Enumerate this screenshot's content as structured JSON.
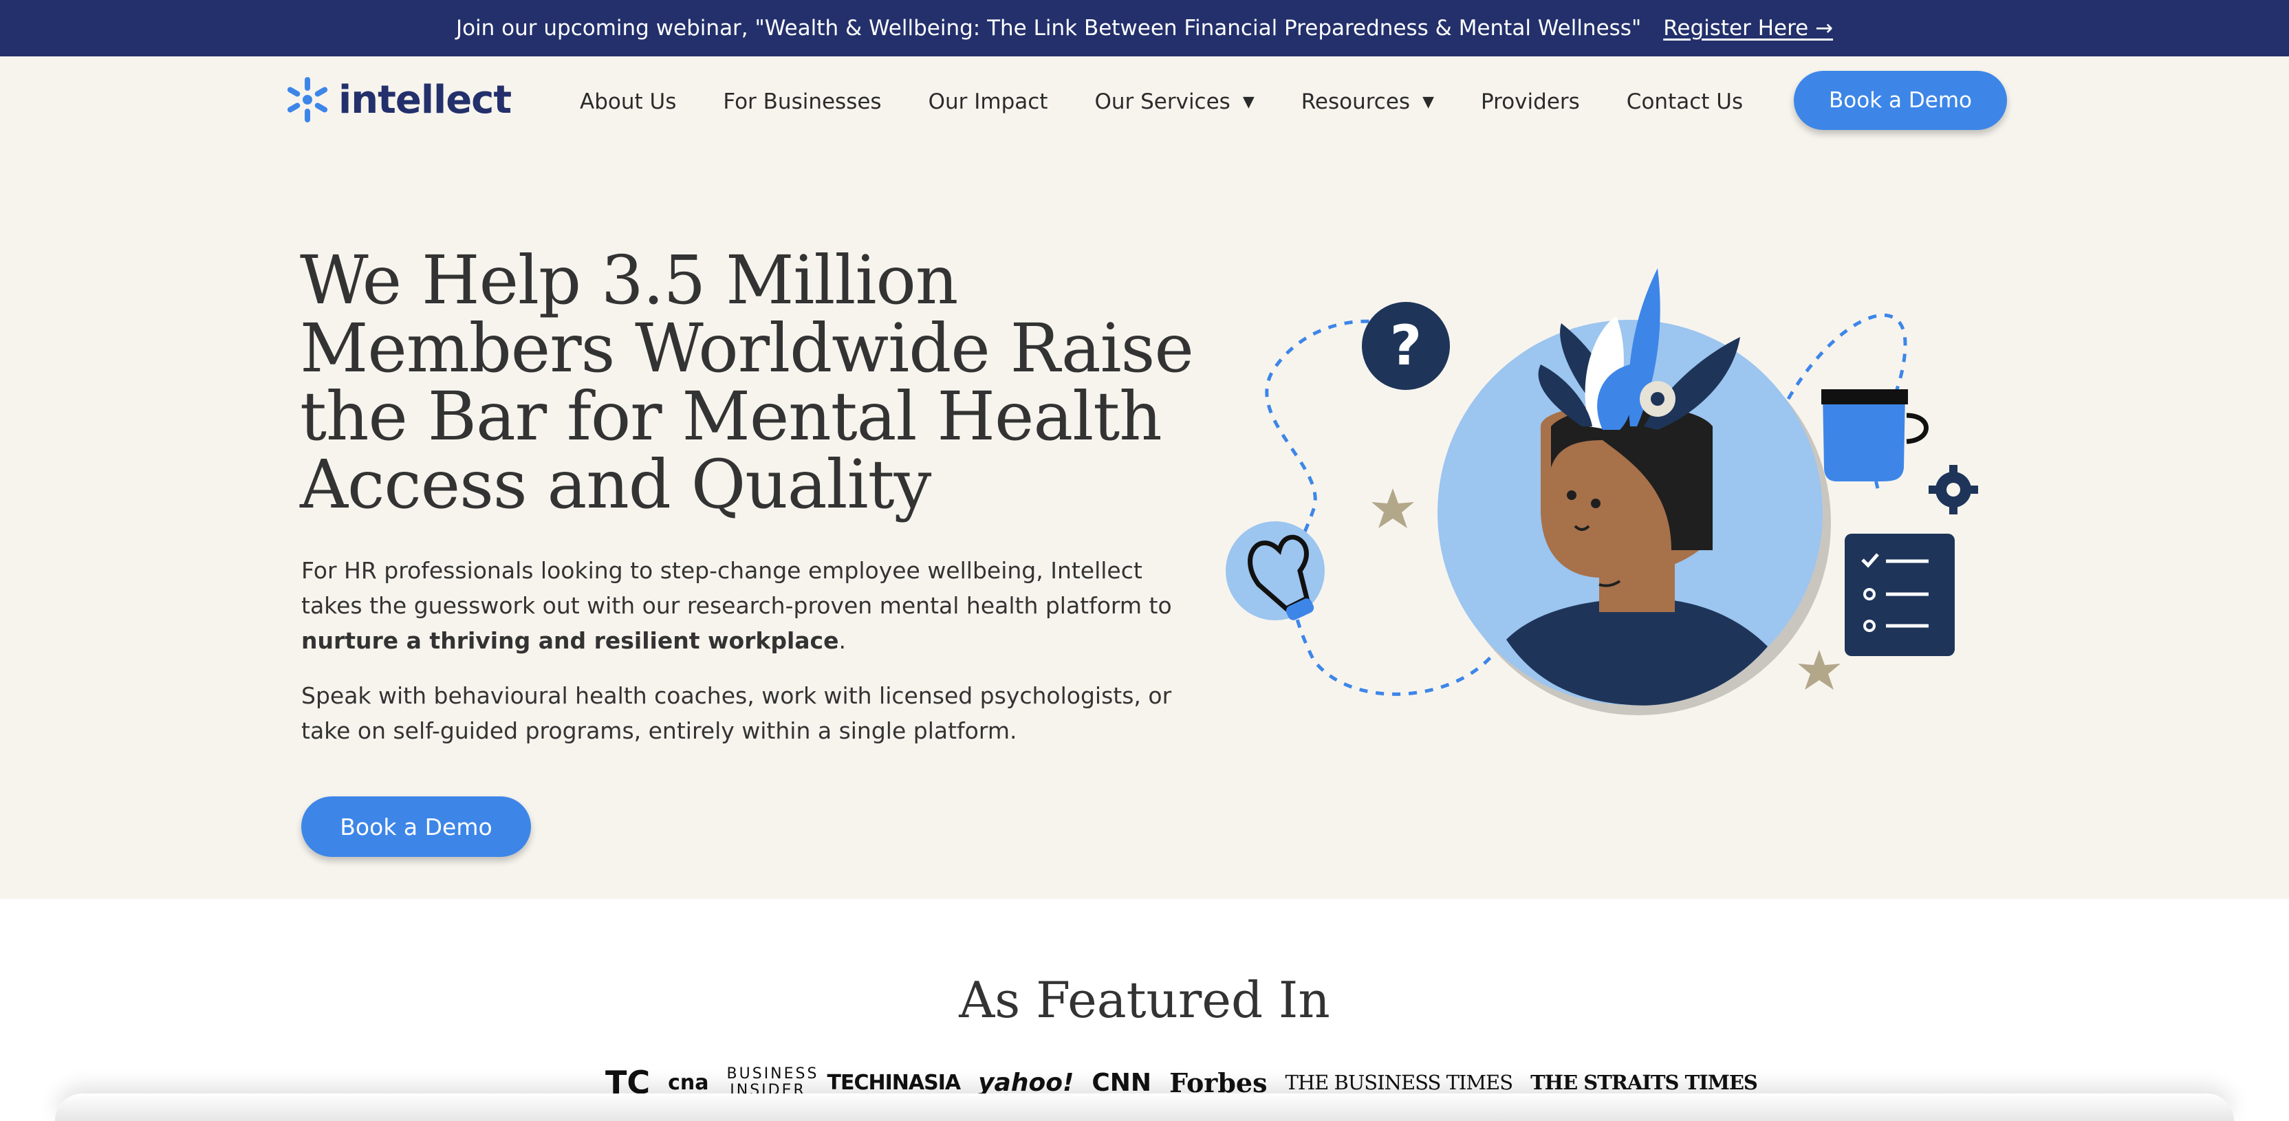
{
  "banner": {
    "text": "Join our upcoming webinar, \"Wealth & Wellbeing: The Link Between Financial Preparedness & Mental Wellness\"",
    "link": "Register Here →"
  },
  "logo": {
    "text": "intellect"
  },
  "nav": {
    "items": [
      {
        "label": "About Us"
      },
      {
        "label": "For Businesses"
      },
      {
        "label": "Our Impact"
      },
      {
        "label": "Our Services",
        "dropdown": true
      },
      {
        "label": "Resources",
        "dropdown": true
      },
      {
        "label": "Providers"
      },
      {
        "label": "Contact Us"
      }
    ],
    "cta": "Book a Demo"
  },
  "hero": {
    "headline": "We Help 3.5 Million Members Worldwide Raise the Bar for Mental Health Access and Quality",
    "para1_a": "For HR professionals looking to step-change employee wellbeing, Intellect takes the guesswork out with our research-proven mental health platform to ",
    "para1_bold": "nurture a thriving and resilient workplace",
    "para1_end": ".",
    "para2": "Speak with behavioural health coaches, work with licensed psychologists, or take on self-guided programs, entirely within a single platform.",
    "cta": "Book a Demo"
  },
  "featured": {
    "title": "As Featured In",
    "logos": [
      "TC",
      "cna",
      "BUSINESS INSIDER",
      "TECHINASIA",
      "yahoo!",
      "CNN",
      "Forbes",
      "THE BUSINESS TIMES",
      "THE STRAITS TIMES"
    ]
  },
  "colors": {
    "navy": "#23306b",
    "accent": "#3d86e8",
    "hero_bg": "#f7f4ee"
  }
}
